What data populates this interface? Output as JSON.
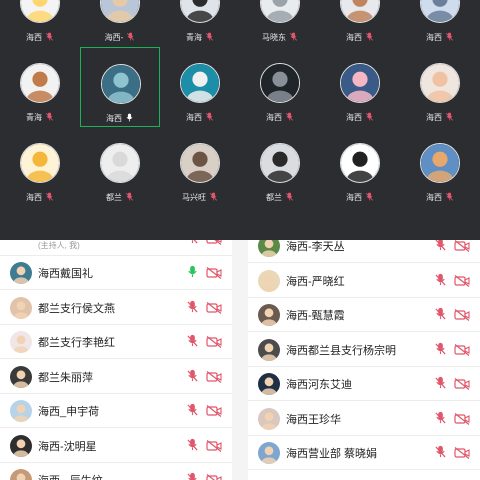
{
  "grid": {
    "rows": [
      {
        "tiles": [
          {
            "name": "海西",
            "mic": "mic-off"
          },
          {
            "name": "海西-",
            "mic": "mic-off"
          },
          {
            "name": "青海",
            "mic": "mic-off"
          },
          {
            "name": "马晓东",
            "mic": "mic-off"
          },
          {
            "name": "海西",
            "mic": "mic-off"
          },
          {
            "name": "海西",
            "mic": "mic-off"
          }
        ]
      },
      {
        "tiles": [
          {
            "name": "青海",
            "mic": "mic-off"
          },
          {
            "name": "海西",
            "mic": "mic-on-white"
          },
          {
            "name": "海西",
            "mic": "mic-off"
          },
          {
            "name": "海西",
            "mic": "mic-off"
          },
          {
            "name": "海西",
            "mic": "mic-off"
          },
          {
            "name": "海西",
            "mic": "mic-off"
          }
        ]
      },
      {
        "tiles": [
          {
            "name": "海西",
            "mic": "mic-off"
          },
          {
            "name": "都兰",
            "mic": "mic-off"
          },
          {
            "name": "马兴旺",
            "mic": "mic-off"
          },
          {
            "name": "都兰",
            "mic": "mic-off"
          },
          {
            "name": "海西",
            "mic": "mic-off"
          },
          {
            "name": "海西",
            "mic": "mic-off"
          }
        ]
      }
    ]
  },
  "left_list": {
    "host_label": "(主持人, 我)",
    "items": [
      {
        "name": "海西戴国礼",
        "mic": "mic-on-green",
        "camera": "camera-off"
      },
      {
        "name": "都兰支行侯文燕",
        "mic": "mic-off",
        "camera": "camera-off"
      },
      {
        "name": "都兰支行李艳红",
        "mic": "mic-off",
        "camera": "camera-off"
      },
      {
        "name": "都兰朱丽萍",
        "mic": "mic-off",
        "camera": "camera-off"
      },
      {
        "name": "海西_申宇荷",
        "mic": "mic-off",
        "camera": "camera-off"
      },
      {
        "name": "海西-沈明星",
        "mic": "mic-off",
        "camera": "camera-off"
      },
      {
        "name": "海西 - 辰生纹",
        "mic": "mic-off",
        "camera": "camera-off"
      }
    ]
  },
  "right_list": {
    "items": [
      {
        "name": "海西-李天丛",
        "mic": "mic-off",
        "camera": "camera-off"
      },
      {
        "name": "海西-严晓红",
        "mic": "mic-off",
        "camera": "camera-off"
      },
      {
        "name": "海西-甄慧霞",
        "mic": "mic-off",
        "camera": "camera-off"
      },
      {
        "name": "海西都兰县支行杨宗明",
        "mic": "mic-off",
        "camera": "camera-off"
      },
      {
        "name": "海西河东艾迪",
        "mic": "mic-off",
        "camera": "camera-off"
      },
      {
        "name": "海西王珍华",
        "mic": "mic-off",
        "camera": "camera-off"
      },
      {
        "name": "海西营业部 蔡晓娟",
        "mic": "mic-off",
        "camera": "camera-off"
      }
    ]
  },
  "colors": {
    "grid_bg": "#2b2d31",
    "mic_muted": "#e0566a",
    "mic_active": "#2bc45b",
    "selected_border": "#19b35a"
  }
}
